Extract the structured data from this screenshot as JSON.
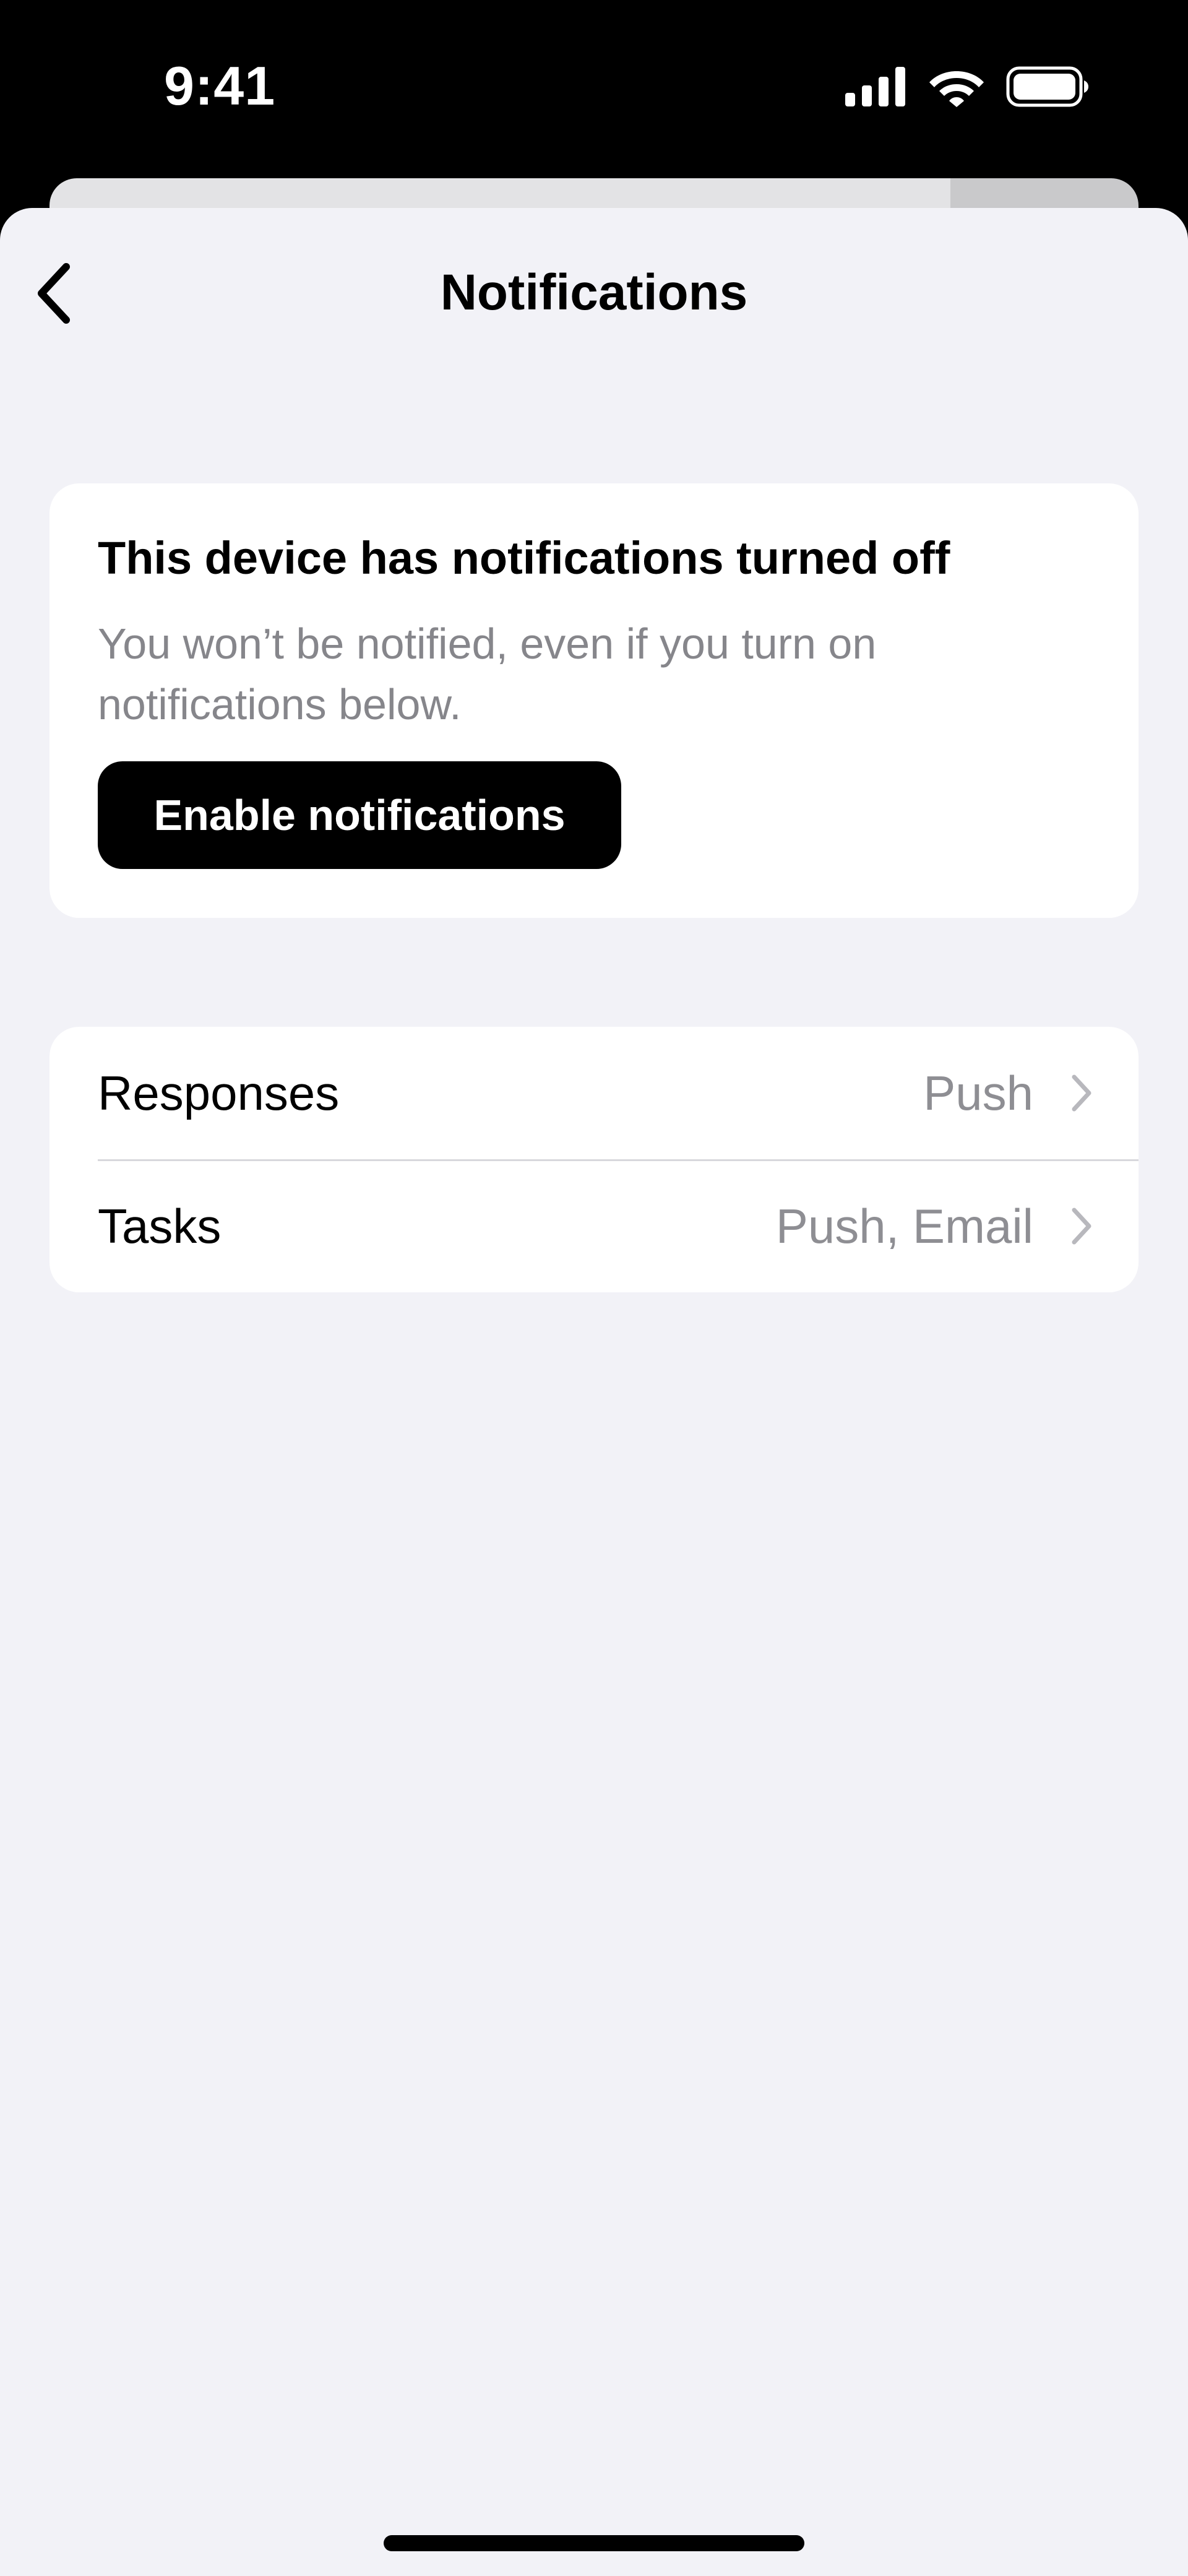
{
  "status_bar": {
    "time": "9:41",
    "icons": [
      "cellular-signal-icon",
      "wifi-icon",
      "battery-icon"
    ]
  },
  "nav": {
    "title": "Notifications",
    "back_icon": "chevron-left-icon"
  },
  "alert": {
    "title": "This device has notifications turned off",
    "body": "You won’t be notified, even if you turn on notifications below.",
    "button_label": "Enable notifications"
  },
  "settings": {
    "rows": [
      {
        "label": "Responses",
        "value": "Push",
        "icon": "chevron-right-icon"
      },
      {
        "label": "Tasks",
        "value": "Push, Email",
        "icon": "chevron-right-icon"
      }
    ]
  },
  "colors": {
    "background": "#f2f2f7",
    "card": "#ffffff",
    "primary_text": "#000000",
    "secondary_text": "#86868b",
    "button": "#000000",
    "button_text": "#ffffff"
  }
}
